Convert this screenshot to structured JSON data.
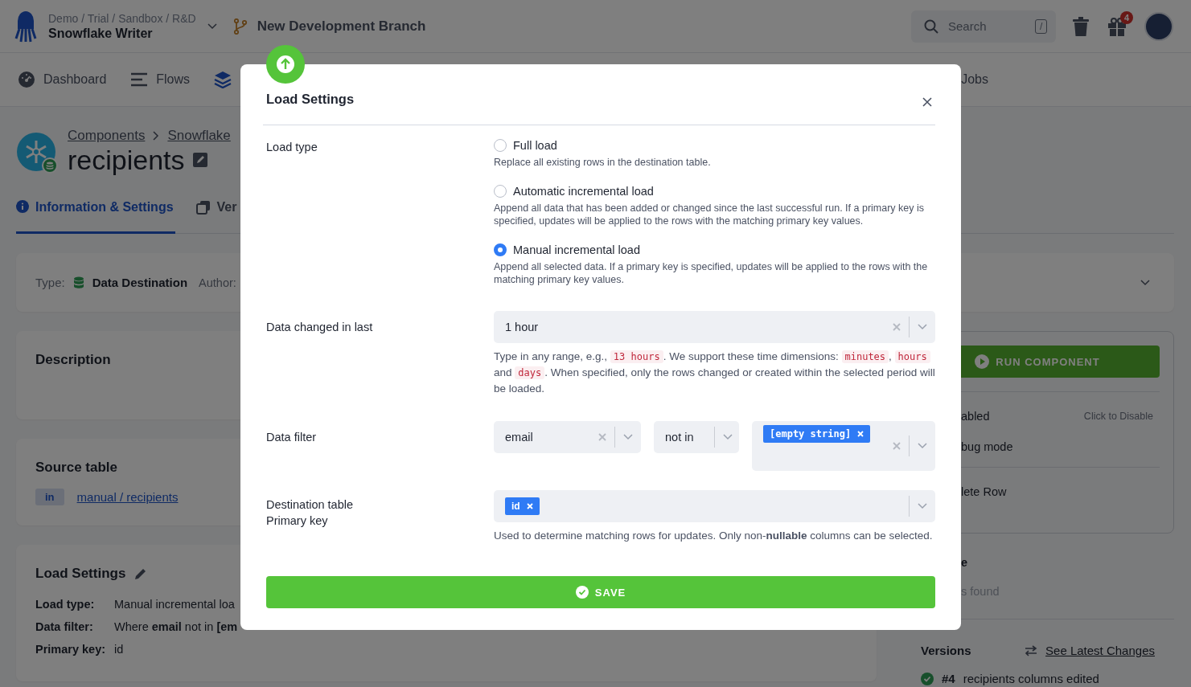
{
  "header": {
    "breadcrumb": "Demo / Trial / Sandbox / R&D",
    "project": "Snowflake Writer",
    "branch": "New Development Branch",
    "search": {
      "placeholder": "Search",
      "shortcut": "/"
    },
    "gift_badge": "4"
  },
  "nav": [
    {
      "kind": "dashboard",
      "label": "Dashboard",
      "selected": false
    },
    {
      "kind": "flows",
      "label": "Flows",
      "selected": false
    },
    {
      "kind": "components",
      "selected": true
    },
    {
      "kind": "jobs",
      "label": "Jobs",
      "selected": false
    }
  ],
  "page": {
    "breadcrumbs": [
      "Components",
      "Snowflake"
    ],
    "title": "recipients",
    "tabs": [
      {
        "kind": "info",
        "label": "Information & Settings",
        "selected": true
      },
      {
        "kind": "versions",
        "label": "Ver",
        "selected": false
      }
    ],
    "info": {
      "type_label": "Type:",
      "type_value": "Data Destination",
      "author_label": "Author:"
    },
    "description": {
      "title": "Description"
    },
    "source_table": {
      "title": "Source table",
      "badge": "in",
      "link": "manual / recipients"
    },
    "load_settings": {
      "title": "Load Settings",
      "rows": [
        {
          "label": "Load type:",
          "value": "Manual incremental loa"
        },
        {
          "label": "Data filter:",
          "value": "Where **email** not in **[em**"
        },
        {
          "label": "Primary key:",
          "value": "id"
        }
      ]
    },
    "sidebar": {
      "run_button": "RUN COMPONENT",
      "status": "abled",
      "status_action": "Click to Disable",
      "debug": "bug mode",
      "delete": "lete Row",
      "section_title": "e",
      "section_empty": "s found",
      "versions": {
        "title": "Versions",
        "link": "See Latest Changes",
        "items": [
          {
            "number": "#4",
            "text": "recipients columns edited"
          }
        ]
      }
    }
  },
  "modal": {
    "title": "Load Settings",
    "load_type": {
      "label": "Load type",
      "options": [
        {
          "label": "Full load",
          "description": "Replace all existing rows in the destination table.",
          "selected": false
        },
        {
          "label": "Automatic incremental load",
          "description": "Append all data that has been added or changed since the last successful run. If a primary key is specified, updates will be applied to the rows with the matching primary key values.",
          "selected": false
        },
        {
          "label": "Manual incremental load",
          "description": "Append all selected data. If a primary key is specified, updates will be applied to the rows with the matching primary key values.",
          "selected": true
        }
      ]
    },
    "data_changed": {
      "label": "Data changed in last",
      "value": "1 hour",
      "help": [
        {
          "kind": "text",
          "text": "Type in any range, e.g., "
        },
        {
          "kind": "code",
          "text": "13 hours"
        },
        {
          "kind": "text",
          "text": ". We support these time dimensions: "
        },
        {
          "kind": "code",
          "text": "minutes"
        },
        {
          "kind": "text",
          "text": ", "
        },
        {
          "kind": "code",
          "text": "hours"
        },
        {
          "kind": "text",
          "text": " and "
        },
        {
          "kind": "code",
          "text": "days"
        },
        {
          "kind": "text",
          "text": ". When specified, only the rows changed or created within the selected period will be loaded."
        }
      ]
    },
    "data_filter": {
      "label": "Data filter",
      "column": "email",
      "operator": "not in",
      "values": [
        "[empty string]"
      ]
    },
    "primary_key": {
      "label_lines": [
        "Destination table",
        "Primary key"
      ],
      "values": [
        "id"
      ],
      "help": "Used to determine matching rows for updates. Only non-**nullable** columns can be selected."
    },
    "save": "SAVE"
  }
}
